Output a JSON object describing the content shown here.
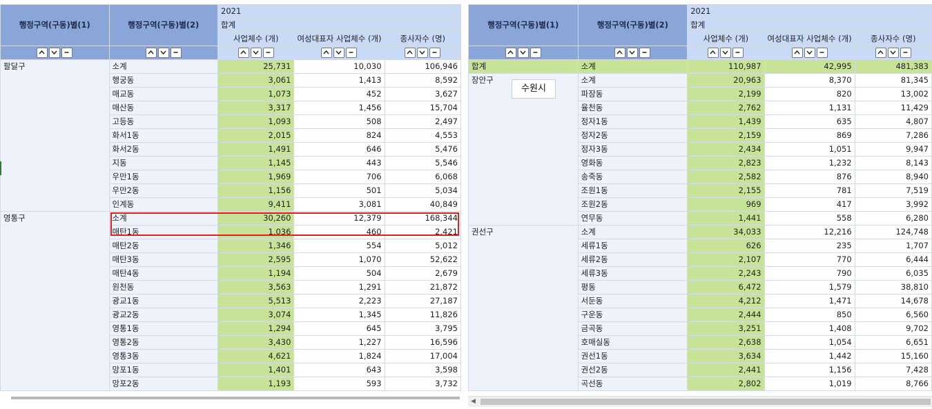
{
  "dim_headers": [
    "행정구역(구동)별(1)",
    "행정구역(구동)별(2)"
  ],
  "year": "2021",
  "subheader": "합계",
  "columns": [
    "사업체수 (개)",
    "여성대표자 사업체수 (개)",
    "종사자수 (명)"
  ],
  "tooltip": "수원시",
  "left": {
    "groups": [
      {
        "name": "팔달구",
        "rows": [
          [
            "소계",
            "25,731",
            "10,030",
            "106,946"
          ],
          [
            "행궁동",
            "3,061",
            "1,413",
            "8,592"
          ],
          [
            "매교동",
            "1,073",
            "452",
            "3,627"
          ],
          [
            "매산동",
            "3,317",
            "1,456",
            "15,704"
          ],
          [
            "고등동",
            "1,093",
            "508",
            "2,497"
          ],
          [
            "화서1동",
            "2,015",
            "824",
            "4,553"
          ],
          [
            "화서2동",
            "1,491",
            "646",
            "5,476"
          ],
          [
            "지동",
            "1,145",
            "443",
            "5,546"
          ],
          [
            "우만1동",
            "1,969",
            "706",
            "6,068"
          ],
          [
            "우만2동",
            "1,156",
            "501",
            "5,034"
          ],
          [
            "인계동",
            "9,411",
            "3,081",
            "40,849"
          ]
        ]
      },
      {
        "name": "영통구",
        "rows": [
          [
            "소계",
            "30,260",
            "12,379",
            "168,344"
          ],
          [
            "매탄1동",
            "1,036",
            "460",
            "2,421"
          ],
          [
            "매탄2동",
            "1,346",
            "554",
            "5,012"
          ],
          [
            "매탄3동",
            "2,595",
            "1,070",
            "52,622"
          ],
          [
            "매탄4동",
            "1,194",
            "504",
            "2,679"
          ],
          [
            "원천동",
            "3,563",
            "1,291",
            "21,872"
          ],
          [
            "광교1동",
            "5,513",
            "2,223",
            "27,187"
          ],
          [
            "광교2동",
            "3,074",
            "1,345",
            "11,826"
          ],
          [
            "영통1동",
            "1,294",
            "645",
            "3,795"
          ],
          [
            "영통2동",
            "3,430",
            "1,227",
            "16,596"
          ],
          [
            "영통3동",
            "4,621",
            "1,824",
            "17,004"
          ],
          [
            "망포1동",
            "1,401",
            "643",
            "3,598"
          ],
          [
            "망포2동",
            "1,193",
            "593",
            "3,732"
          ]
        ]
      }
    ]
  },
  "right": {
    "groups": [
      {
        "name": "합계",
        "highlight": true,
        "rows": [
          [
            "소계",
            "110,987",
            "42,995",
            "481,383"
          ]
        ]
      },
      {
        "name": "장안구",
        "rows": [
          [
            "소계",
            "20,963",
            "8,370",
            "81,345"
          ],
          [
            "파장동",
            "2,199",
            "820",
            "13,002"
          ],
          [
            "율천동",
            "2,762",
            "1,131",
            "11,429"
          ],
          [
            "정자1동",
            "1,439",
            "635",
            "4,807"
          ],
          [
            "정자2동",
            "2,159",
            "869",
            "7,286"
          ],
          [
            "정자3동",
            "2,434",
            "1,051",
            "9,947"
          ],
          [
            "영화동",
            "2,823",
            "1,232",
            "8,143"
          ],
          [
            "송죽동",
            "2,582",
            "876",
            "8,940"
          ],
          [
            "조원1동",
            "2,155",
            "781",
            "7,519"
          ],
          [
            "조원2동",
            "969",
            "417",
            "3,992"
          ],
          [
            "연무동",
            "1,441",
            "558",
            "6,280"
          ]
        ]
      },
      {
        "name": "권선구",
        "rows": [
          [
            "소계",
            "34,033",
            "12,216",
            "124,748"
          ],
          [
            "세류1동",
            "626",
            "235",
            "1,707"
          ],
          [
            "세류2동",
            "2,107",
            "770",
            "6,444"
          ],
          [
            "세류3동",
            "2,243",
            "790",
            "6,035"
          ],
          [
            "평동",
            "6,472",
            "1,579",
            "38,810"
          ],
          [
            "서둔동",
            "4,212",
            "1,471",
            "14,678"
          ],
          [
            "구운동",
            "2,444",
            "850",
            "6,560"
          ],
          [
            "금곡동",
            "3,251",
            "1,408",
            "9,702"
          ],
          [
            "호매실동",
            "2,638",
            "1,054",
            "6,651"
          ],
          [
            "권선1동",
            "3,634",
            "1,442",
            "15,160"
          ],
          [
            "권선2동",
            "2,441",
            "1,156",
            "7,428"
          ],
          [
            "곡선동",
            "2,802",
            "1,019",
            "8,766"
          ]
        ]
      }
    ]
  }
}
